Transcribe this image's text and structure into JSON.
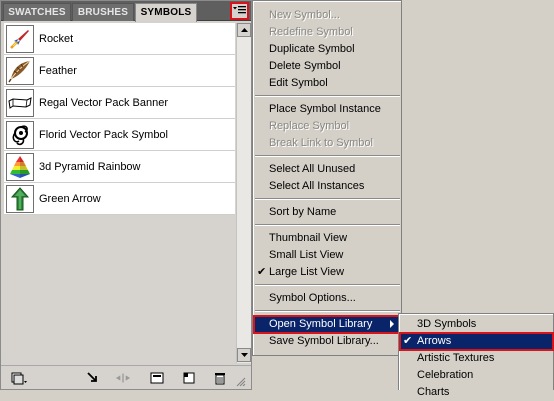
{
  "panel": {
    "tabs": [
      {
        "label": "SWATCHES"
      },
      {
        "label": "BRUSHES"
      },
      {
        "label": "SYMBOLS"
      }
    ],
    "symbols": [
      {
        "label": "Rocket",
        "icon": "rocket-icon"
      },
      {
        "label": "Feather",
        "icon": "feather-icon"
      },
      {
        "label": "Regal Vector Pack Banner",
        "icon": "banner-icon"
      },
      {
        "label": "Florid Vector Pack Symbol",
        "icon": "florid-icon"
      },
      {
        "label": "3d Pyramid Rainbow",
        "icon": "pyramid-icon"
      },
      {
        "label": "Green Arrow",
        "icon": "green-arrow-icon"
      }
    ]
  },
  "menu": {
    "items": [
      {
        "label": "New Symbol...",
        "enabled": false
      },
      {
        "label": "Redefine Symbol",
        "enabled": false
      },
      {
        "label": "Duplicate Symbol",
        "enabled": true
      },
      {
        "label": "Delete Symbol",
        "enabled": true
      },
      {
        "label": "Edit Symbol",
        "enabled": true
      },
      {
        "label": "Place Symbol Instance",
        "enabled": true
      },
      {
        "label": "Replace Symbol",
        "enabled": false
      },
      {
        "label": "Break Link to Symbol",
        "enabled": false
      },
      {
        "label": "Select All Unused",
        "enabled": true
      },
      {
        "label": "Select All Instances",
        "enabled": true
      },
      {
        "label": "Sort by Name",
        "enabled": true
      },
      {
        "label": "Thumbnail View",
        "enabled": true
      },
      {
        "label": "Small List View",
        "enabled": true
      },
      {
        "label": "Large List View",
        "enabled": true,
        "checked": true
      },
      {
        "label": "Symbol Options...",
        "enabled": true
      },
      {
        "label": "Open Symbol Library",
        "enabled": true,
        "highlighted": true
      },
      {
        "label": "Save Symbol Library...",
        "enabled": true
      }
    ]
  },
  "submenu": {
    "items": [
      {
        "label": "3D Symbols"
      },
      {
        "label": "Arrows",
        "checked": true,
        "highlighted": true
      },
      {
        "label": "Artistic Textures"
      },
      {
        "label": "Celebration"
      },
      {
        "label": "Charts"
      }
    ]
  },
  "colors": {
    "highlight": "#0a246a",
    "callout": "#d8141a"
  }
}
